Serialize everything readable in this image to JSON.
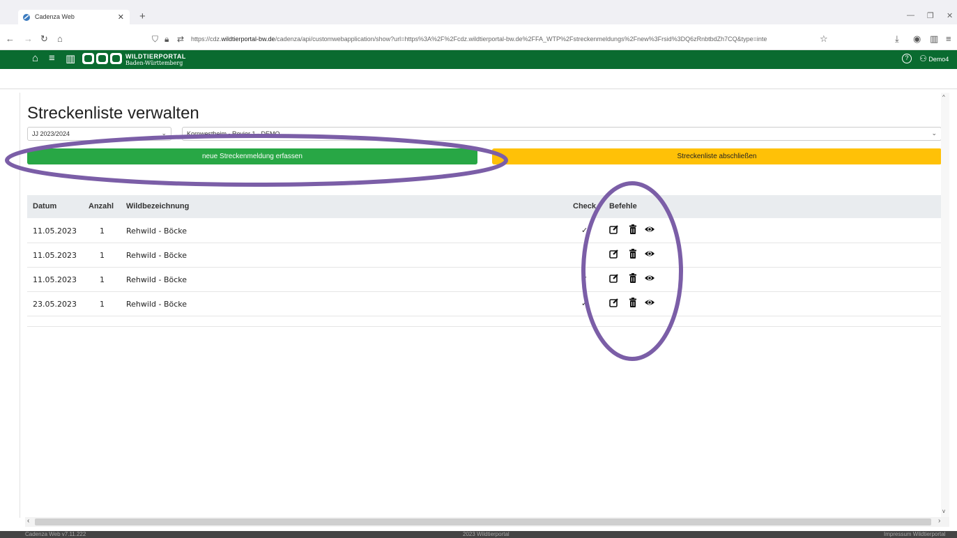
{
  "browser": {
    "tab_title": "Cadenza Web",
    "url_prefix": "https://cdz.",
    "url_domain": "wildtierportal-bw.de",
    "url_rest": "/cadenza/api/customwebapplication/show?url=https%3A%2F%2Fcdz.wildtierportal-bw.de%2FFA_WTP%2Fstreckenmeldungs%2Fnew%3Frsid%3DQ6zRnbtbdZh7CQ&type=inte"
  },
  "app": {
    "brand_line1": "WILDTIERPORTAL",
    "brand_line2": "Baden-Württemberg",
    "help_symbol": "?",
    "user_name": "Demo4",
    "brand_color": "#0a6b30"
  },
  "page": {
    "title": "Streckenliste verwalten",
    "season_select": "JJ 2023/2024",
    "revier_select": "Kornwestheim - Revier 1 - DEMO",
    "new_button": "neue Streckenmeldung erfassen",
    "close_button": "Streckenliste abschließen"
  },
  "table": {
    "headers": {
      "datum": "Datum",
      "anzahl": "Anzahl",
      "wild": "Wildbezeichnung",
      "check": "Check",
      "befehle": "Befehle"
    },
    "rows": [
      {
        "datum": "11.05.2023",
        "anzahl": "1",
        "wild": "Rehwild - Böcke",
        "check": "✓"
      },
      {
        "datum": "11.05.2023",
        "anzahl": "1",
        "wild": "Rehwild - Böcke",
        "check": "✓"
      },
      {
        "datum": "11.05.2023",
        "anzahl": "1",
        "wild": "Rehwild - Böcke",
        "check": "✓"
      },
      {
        "datum": "23.05.2023",
        "anzahl": "1",
        "wild": "Rehwild - Böcke",
        "check": "✓"
      }
    ],
    "row_icons": [
      "edit-icon",
      "trash-icon",
      "eye-icon"
    ]
  },
  "footer": {
    "left": "Cadenza Web v7.11.222",
    "center": "2023 Wildtierportal",
    "right": "Impressum Wildtierportal"
  },
  "colors": {
    "green_button": "#28a745",
    "yellow_button": "#ffc107",
    "annotation": "#7b5ea7"
  }
}
